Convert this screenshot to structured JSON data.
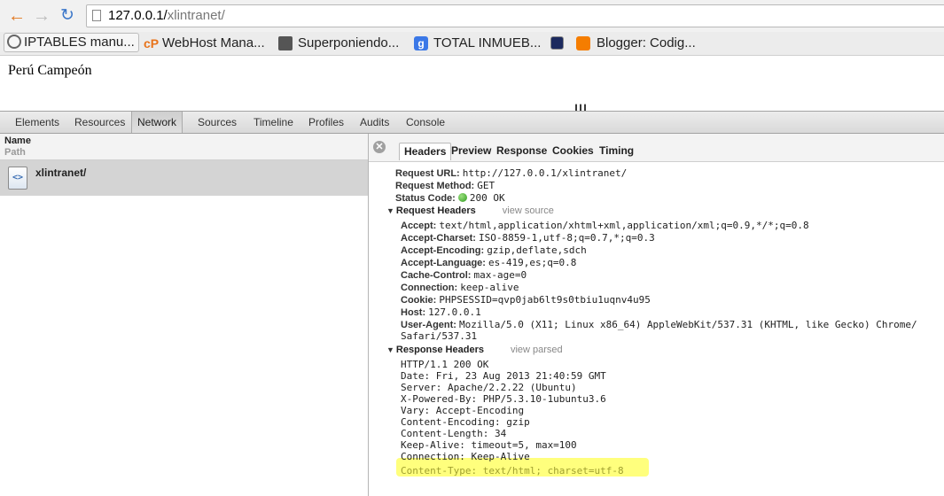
{
  "browser": {
    "url_host": "127.0.0.1/",
    "url_path": "xlintranet/"
  },
  "bookmarks": [
    {
      "label": "IPTABLES manu...",
      "icon": "globe-icon"
    },
    {
      "label": "WebHost Mana...",
      "icon": "cpanel-icon",
      "badge": "cP"
    },
    {
      "label": "Superponiendo...",
      "icon": "avatar-icon"
    },
    {
      "label": "TOTAL INMUEB...",
      "icon": "google-icon",
      "badge": "g"
    },
    {
      "label": "",
      "icon": "app-icon"
    },
    {
      "label": "Blogger: Codig...",
      "icon": "blogger-icon"
    }
  ],
  "page": {
    "text": "Perú Campeón"
  },
  "devtools": {
    "tabs": [
      "Elements",
      "Resources",
      "Network",
      "Sources",
      "Timeline",
      "Profiles",
      "Audits",
      "Console"
    ],
    "active_tab": "Network",
    "columns": {
      "name": "Name",
      "path": "Path"
    },
    "request": {
      "name": "xlintranet/"
    },
    "detail_tabs": [
      "Headers",
      "Preview",
      "Response",
      "Cookies",
      "Timing"
    ],
    "active_detail_tab": "Headers",
    "general": {
      "request_url_label": "Request URL:",
      "request_url": "http://127.0.0.1/xlintranet/",
      "method_label": "Request Method:",
      "method": "GET",
      "status_label": "Status Code:",
      "status": "200 OK"
    },
    "request_headers_title": "Request Headers",
    "view_source": "view source",
    "request_headers": [
      {
        "k": "Accept:",
        "v": "text/html,application/xhtml+xml,application/xml;q=0.9,*/*;q=0.8"
      },
      {
        "k": "Accept-Charset:",
        "v": "ISO-8859-1,utf-8;q=0.7,*;q=0.3"
      },
      {
        "k": "Accept-Encoding:",
        "v": "gzip,deflate,sdch"
      },
      {
        "k": "Accept-Language:",
        "v": "es-419,es;q=0.8"
      },
      {
        "k": "Cache-Control:",
        "v": "max-age=0"
      },
      {
        "k": "Connection:",
        "v": "keep-alive"
      },
      {
        "k": "Cookie:",
        "v": "PHPSESSID=qvp0jab6lt9s0tbiu1uqnv4u95"
      },
      {
        "k": "Host:",
        "v": "127.0.0.1"
      },
      {
        "k": "User-Agent:",
        "v": "Mozilla/5.0 (X11; Linux x86_64) AppleWebKit/537.31 (KHTML, like Gecko) Chrome/"
      }
    ],
    "user_agent_cont": "Safari/537.31",
    "response_headers_title": "Response Headers",
    "view_parsed": "view parsed",
    "response_headers": [
      "HTTP/1.1 200 OK",
      "Date: Fri, 23 Aug 2013 21:40:59 GMT",
      "Server: Apache/2.2.22 (Ubuntu)",
      "X-Powered-By: PHP/5.3.10-1ubuntu3.6",
      "Vary: Accept-Encoding",
      "Content-Encoding: gzip",
      "Content-Length: 34",
      "Keep-Alive: timeout=5, max=100",
      "Connection: Keep-Alive",
      "Content-Type: text/html; charset=utf-8"
    ]
  },
  "colors": {
    "highlight": "#ffff66",
    "status_ok": "#2f9b20"
  }
}
